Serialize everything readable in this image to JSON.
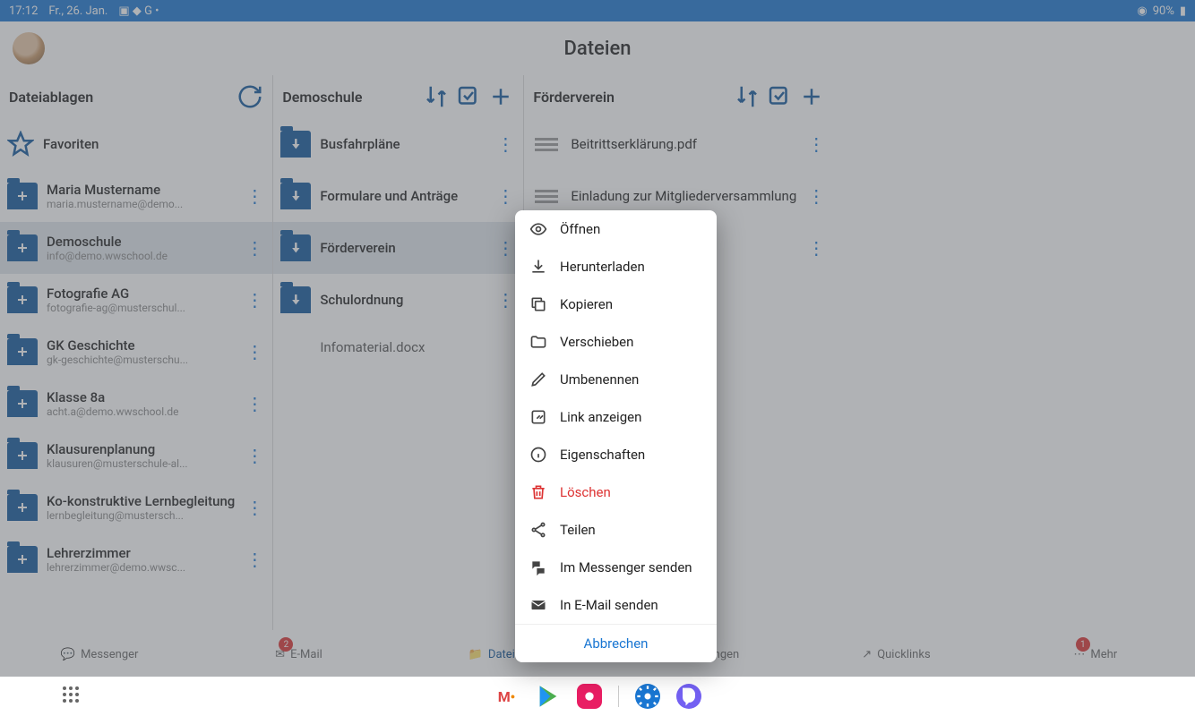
{
  "status": {
    "time": "17:12",
    "date": "Fr., 26. Jan.",
    "battery": "90%"
  },
  "app": {
    "title": "Dateien"
  },
  "col1": {
    "title": "Dateiablagen",
    "fav": "Favoriten",
    "items": [
      {
        "name": "Maria Mustername",
        "sub": "maria.mustername@demo..."
      },
      {
        "name": "Demoschule",
        "sub": "info@demo.wwschool.de"
      },
      {
        "name": "Fotografie AG",
        "sub": "fotografie-ag@musterschul..."
      },
      {
        "name": "GK Geschichte",
        "sub": "gk-geschichte@musterschu..."
      },
      {
        "name": "Klasse 8a",
        "sub": "acht.a@demo.wwschool.de"
      },
      {
        "name": "Klausurenplanung",
        "sub": "klausuren@musterschule-al..."
      },
      {
        "name": "Ko-konstruktive Lernbegleitung",
        "sub": "lernbegleitung@mustersch..."
      },
      {
        "name": "Lehrerzimmer",
        "sub": "lehrerzimmer@demo.wwsc..."
      }
    ]
  },
  "col2": {
    "title": "Demoschule",
    "items": [
      {
        "name": "Busfahrpläne"
      },
      {
        "name": "Formulare und Anträge"
      },
      {
        "name": "Förderverein"
      },
      {
        "name": "Schulordnung"
      }
    ],
    "file": "Infomaterial.docx"
  },
  "col3": {
    "title": "Förderverein",
    "items": [
      {
        "name": "Beitrittserklärung.pdf"
      },
      {
        "name": "Einladung zur Mitgliederversammlung"
      },
      {
        "name": ""
      }
    ]
  },
  "menu": {
    "items": [
      {
        "icon": "eye",
        "label": "Öffnen"
      },
      {
        "icon": "download",
        "label": "Herunterladen"
      },
      {
        "icon": "copy",
        "label": "Kopieren"
      },
      {
        "icon": "folder",
        "label": "Verschieben"
      },
      {
        "icon": "pencil",
        "label": "Umbenennen"
      },
      {
        "icon": "link",
        "label": "Link anzeigen"
      },
      {
        "icon": "info",
        "label": "Eigenschaften"
      },
      {
        "icon": "trash",
        "label": "Löschen",
        "danger": true
      },
      {
        "icon": "share",
        "label": "Teilen"
      },
      {
        "icon": "chat",
        "label": "Im Messenger senden"
      },
      {
        "icon": "mail",
        "label": "In E-Mail senden"
      }
    ],
    "cancel": "Abbrechen"
  },
  "nav": {
    "items": [
      {
        "label": "Messenger"
      },
      {
        "label": "E-Mail",
        "badge": "2"
      },
      {
        "label": "Dateien",
        "active": true
      },
      {
        "label": "Mitteilungen"
      },
      {
        "label": "Quicklinks"
      },
      {
        "label": "Mehr",
        "badge": "1"
      }
    ]
  }
}
